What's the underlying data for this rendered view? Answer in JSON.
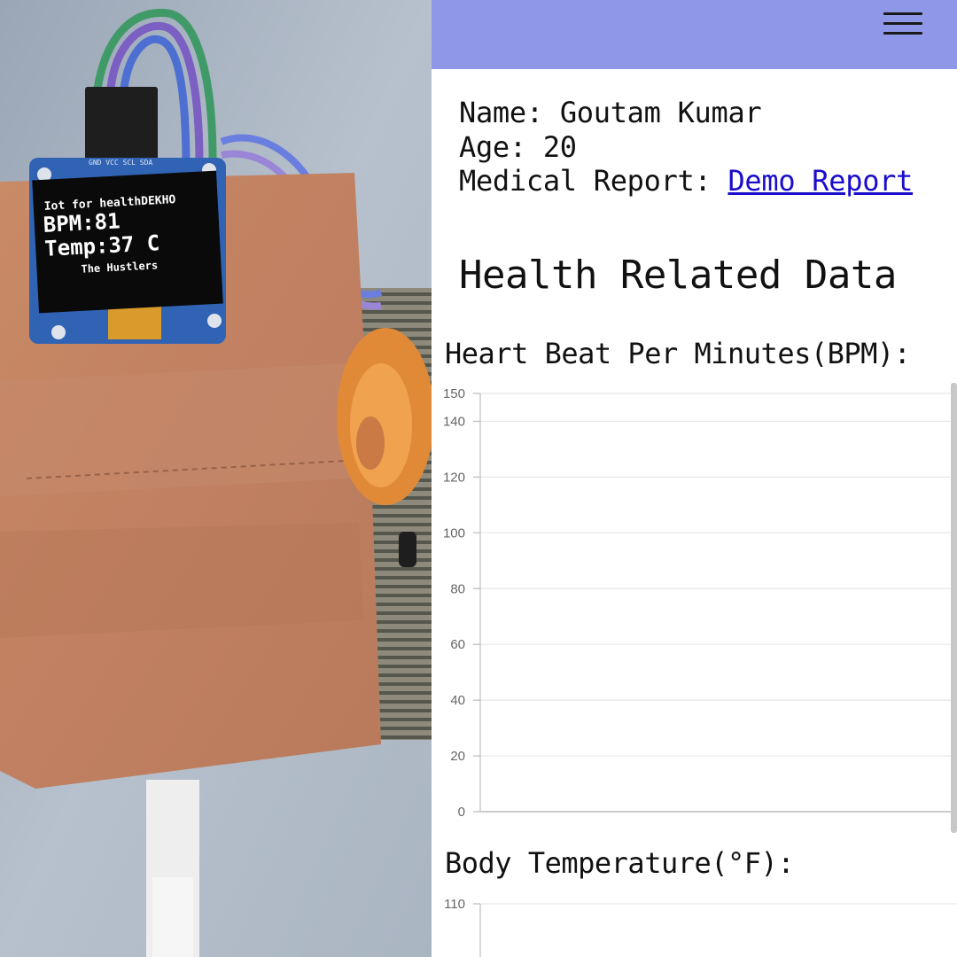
{
  "photo": {
    "oled": {
      "line1": "Iot for healthDEKHO",
      "line2": "BPM:81",
      "line3": "Temp:37 C",
      "line4": "The Hustlers"
    },
    "pin_labels": "GND VCC SCL SDA"
  },
  "header": {
    "menu_icon": "hamburger-icon",
    "color": "#8f98e8"
  },
  "patient": {
    "name_label": "Name:",
    "name_value": "Goutam Kumar",
    "age_label": "Age:",
    "age_value": "20",
    "report_label": "Medical Report:",
    "report_link": "Demo Report"
  },
  "section_title": "Health Related Data",
  "chart_data": [
    {
      "type": "line",
      "title": "Heart Beat Per Minutes(BPM):",
      "x": [],
      "series": [],
      "yticks": [
        0,
        20,
        40,
        60,
        80,
        100,
        120,
        140,
        150
      ],
      "ylim": [
        0,
        150
      ],
      "grid": true
    },
    {
      "type": "line",
      "title": "Body Temperature(°F):",
      "x": [],
      "series": [],
      "yticks": [
        110
      ],
      "grid": true
    }
  ]
}
